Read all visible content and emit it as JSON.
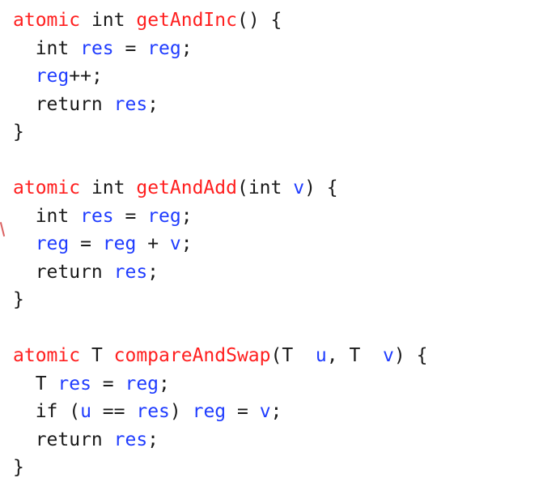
{
  "code_lines": [
    [
      {
        "t": "atomic",
        "c": "red"
      },
      {
        "t": " int ",
        "c": "dark"
      },
      {
        "t": "getAndInc",
        "c": "red"
      },
      {
        "t": "() {",
        "c": "dark"
      }
    ],
    [
      {
        "t": "  int ",
        "c": "dark"
      },
      {
        "t": "res",
        "c": "blue"
      },
      {
        "t": " = ",
        "c": "dark"
      },
      {
        "t": "reg",
        "c": "blue"
      },
      {
        "t": ";",
        "c": "dark"
      }
    ],
    [
      {
        "t": "  ",
        "c": "dark"
      },
      {
        "t": "reg",
        "c": "blue"
      },
      {
        "t": "++;",
        "c": "dark"
      }
    ],
    [
      {
        "t": "  return ",
        "c": "dark"
      },
      {
        "t": "res",
        "c": "blue"
      },
      {
        "t": ";",
        "c": "dark"
      }
    ],
    [
      {
        "t": "}",
        "c": "dark"
      }
    ],
    [
      {
        "t": "",
        "c": "dark"
      }
    ],
    [
      {
        "t": "atomic",
        "c": "red"
      },
      {
        "t": " int ",
        "c": "dark"
      },
      {
        "t": "getAndAdd",
        "c": "red"
      },
      {
        "t": "(int ",
        "c": "dark"
      },
      {
        "t": "v",
        "c": "blue"
      },
      {
        "t": ") {",
        "c": "dark"
      }
    ],
    [
      {
        "t": "  int ",
        "c": "dark"
      },
      {
        "t": "res",
        "c": "blue"
      },
      {
        "t": " = ",
        "c": "dark"
      },
      {
        "t": "reg",
        "c": "blue"
      },
      {
        "t": ";",
        "c": "dark"
      }
    ],
    [
      {
        "t": "  ",
        "c": "dark"
      },
      {
        "t": "reg",
        "c": "blue"
      },
      {
        "t": " = ",
        "c": "dark"
      },
      {
        "t": "reg",
        "c": "blue"
      },
      {
        "t": " + ",
        "c": "dark"
      },
      {
        "t": "v",
        "c": "blue"
      },
      {
        "t": ";",
        "c": "dark"
      }
    ],
    [
      {
        "t": "  return ",
        "c": "dark"
      },
      {
        "t": "res",
        "c": "blue"
      },
      {
        "t": ";",
        "c": "dark"
      }
    ],
    [
      {
        "t": "}",
        "c": "dark"
      }
    ],
    [
      {
        "t": "",
        "c": "dark"
      }
    ],
    [
      {
        "t": "atomic",
        "c": "red"
      },
      {
        "t": " T ",
        "c": "dark"
      },
      {
        "t": "compareAndSwap",
        "c": "red"
      },
      {
        "t": "(T  ",
        "c": "dark"
      },
      {
        "t": "u",
        "c": "blue"
      },
      {
        "t": ", T  ",
        "c": "dark"
      },
      {
        "t": "v",
        "c": "blue"
      },
      {
        "t": ") {",
        "c": "dark"
      }
    ],
    [
      {
        "t": "  T ",
        "c": "dark"
      },
      {
        "t": "res",
        "c": "blue"
      },
      {
        "t": " = ",
        "c": "dark"
      },
      {
        "t": "reg",
        "c": "blue"
      },
      {
        "t": ";",
        "c": "dark"
      }
    ],
    [
      {
        "t": "  if (",
        "c": "dark"
      },
      {
        "t": "u",
        "c": "blue"
      },
      {
        "t": " == ",
        "c": "dark"
      },
      {
        "t": "res",
        "c": "blue"
      },
      {
        "t": ") ",
        "c": "dark"
      },
      {
        "t": "reg",
        "c": "blue"
      },
      {
        "t": " = ",
        "c": "dark"
      },
      {
        "t": "v",
        "c": "blue"
      },
      {
        "t": ";",
        "c": "dark"
      }
    ],
    [
      {
        "t": "  return ",
        "c": "dark"
      },
      {
        "t": "res",
        "c": "blue"
      },
      {
        "t": ";",
        "c": "dark"
      }
    ],
    [
      {
        "t": "}",
        "c": "dark"
      }
    ]
  ],
  "colors": {
    "keyword_red": "#ff1f1f",
    "identifier_blue": "#1f3cff",
    "text_dark": "#1a1a1a",
    "background": "#ffffff"
  }
}
